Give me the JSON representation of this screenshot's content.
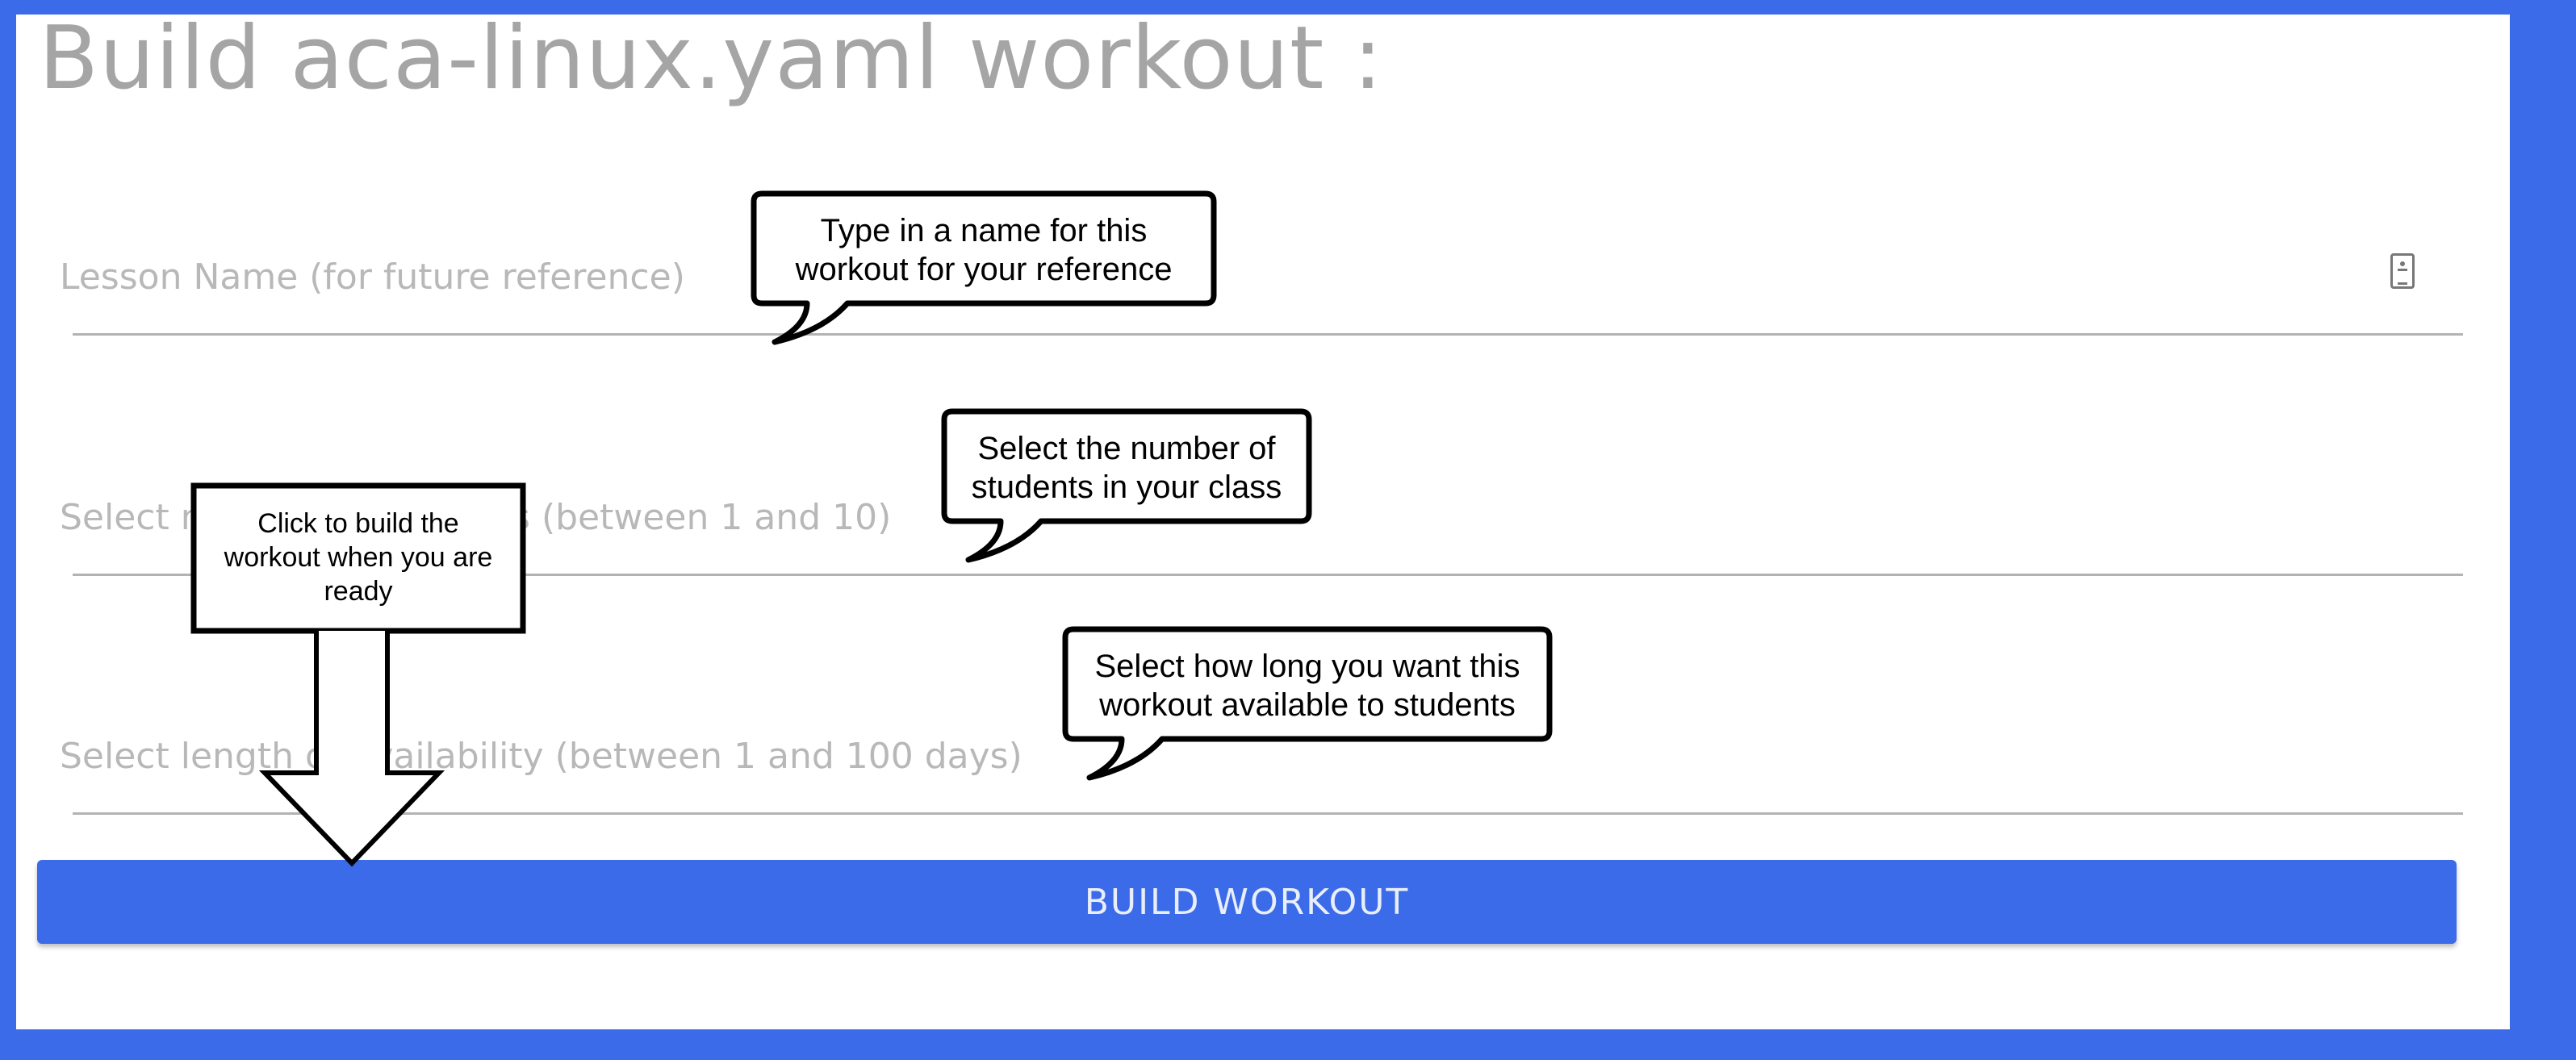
{
  "page": {
    "title": "Build aca-linux.yaml workout :"
  },
  "form": {
    "lesson_name": {
      "placeholder": "Lesson Name (for future reference)"
    },
    "num_students": {
      "placeholder": "Select number of students (between 1 and 10)"
    },
    "availability": {
      "placeholder": "Select length of availability (between 1 and 100 days)"
    },
    "build_button_label": "BUILD WORKOUT"
  },
  "annotations": {
    "name_tip": {
      "line1": "Type in a name for this",
      "line2": "workout for your reference"
    },
    "students_tip": {
      "line1": "Select the number of",
      "line2": "students in your class"
    },
    "availability_tip": {
      "line1": "Select how long you want this",
      "line2": "workout available to students"
    },
    "build_tip": {
      "line1": "Click to build the",
      "line2": "workout when you are",
      "line3": "ready"
    }
  },
  "colors": {
    "background": "#3b6be8",
    "button": "#3b6be8",
    "title": "#a5a5a5",
    "placeholder": "#b8b8b8"
  },
  "icons": {
    "field_icon": "contact-card-icon"
  }
}
